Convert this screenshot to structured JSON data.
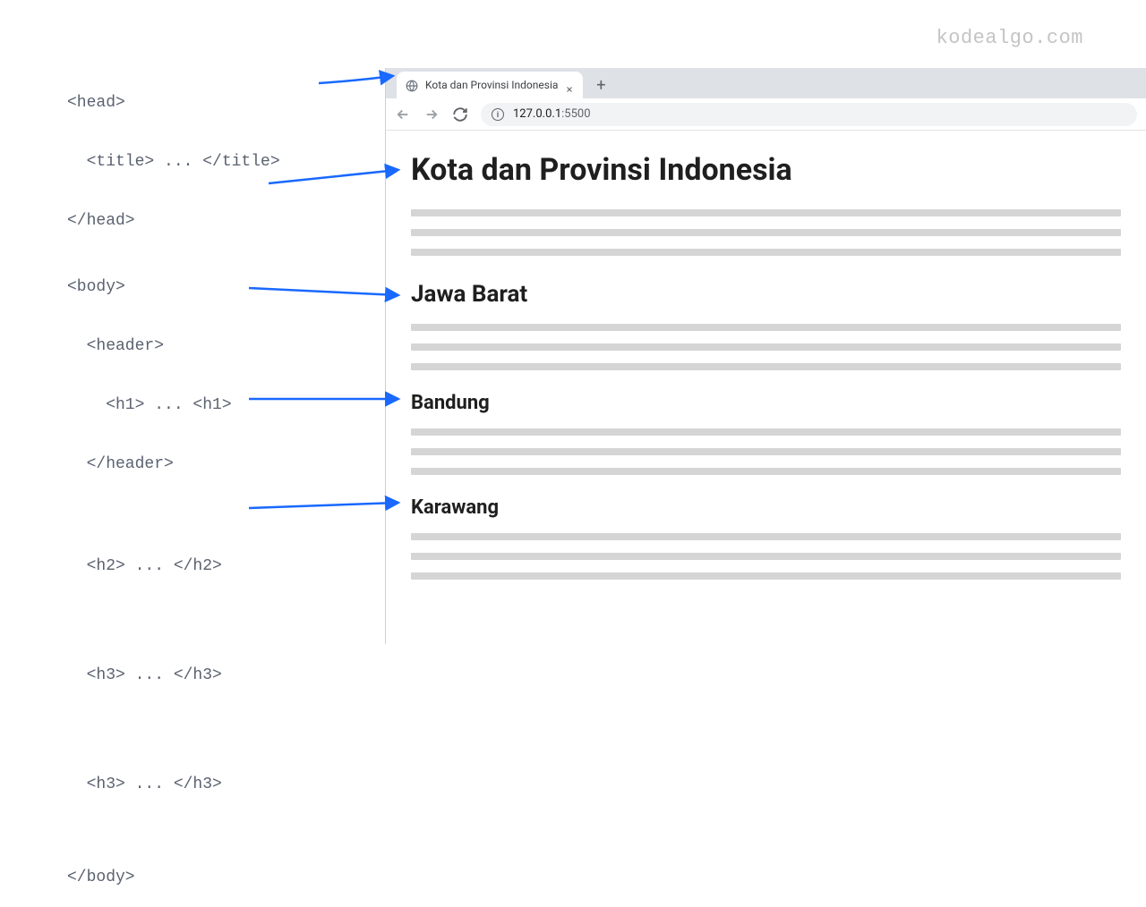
{
  "watermark": "kodealgo.com",
  "code": {
    "l1": "<head>",
    "l2": "  <title> ... </title>",
    "l3": "</head>",
    "l4": "<body>",
    "l5": "  <header>",
    "l6": "    <h1> ... <h1>",
    "l7": "  </header>",
    "l8": "  <h2> ... </h2>",
    "l9": "  <h3> ... </h3>",
    "l10": "  <h3> ... </h3>",
    "l11": "</body>"
  },
  "browser": {
    "tab_title": "Kota dan Provinsi Indonesia",
    "new_tab": "+",
    "url_host": "127.0.0.1",
    "url_port": ":5500"
  },
  "page": {
    "h1": "Kota dan Provinsi Indonesia",
    "h2": "Jawa Barat",
    "h3_1": "Bandung",
    "h3_2": "Karawang"
  }
}
